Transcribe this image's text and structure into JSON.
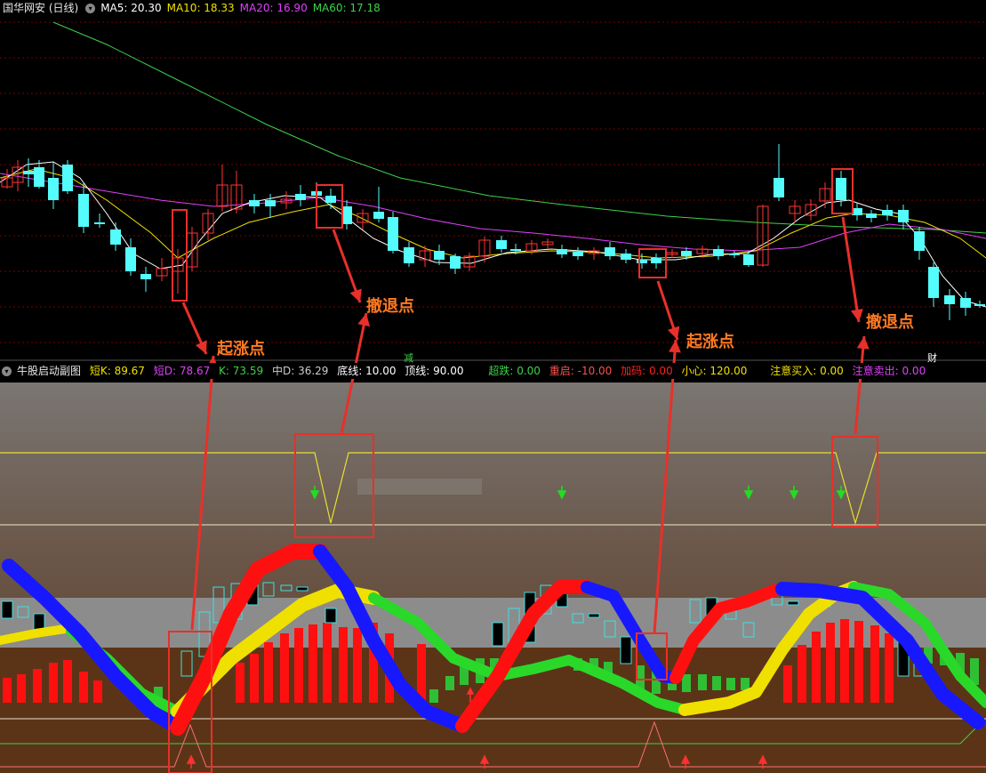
{
  "header": {
    "stock": "国华网安 (日线)",
    "ma": [
      {
        "label": "MA5: 20.30",
        "color": "#ffffff"
      },
      {
        "label": "MA10: 18.33",
        "color": "#f0e000"
      },
      {
        "label": "MA20: 16.90",
        "color": "#e040fb"
      },
      {
        "label": "MA60: 17.18",
        "color": "#3fd14a"
      }
    ]
  },
  "sub_header": {
    "title": "牛股启动副图",
    "items": [
      {
        "label": "短K: 89.67",
        "color": "#f0e000"
      },
      {
        "label": "短D: 78.67",
        "color": "#e040fb"
      },
      {
        "label": "K: 73.59",
        "color": "#3fd14a"
      },
      {
        "label": "中D: 36.29",
        "color": "#cccccc"
      },
      {
        "label": "底线: 10.00",
        "color": "#ffffff"
      },
      {
        "label": "顶线: 90.00",
        "color": "#ffffff"
      },
      {
        "label": "超跌: 0.00",
        "color": "#3fd14a"
      },
      {
        "label": "重启: -10.00",
        "color": "#ff5050"
      },
      {
        "label": "加码: 0.00",
        "color": "#ff2020"
      },
      {
        "label": "小心: 120.00",
        "color": "#f0e000"
      },
      {
        "label": "注意买入: 0.00",
        "color": "#f0e000"
      },
      {
        "label": "注意卖出: 0.00",
        "color": "#e040fb"
      }
    ]
  },
  "tags": {
    "reduce": "减",
    "finance": "财"
  },
  "annotations": {
    "rise": "起涨点",
    "retreat": "撤退点"
  },
  "colors": {
    "up": "#ff3333",
    "down": "#54fcfc",
    "ma5": "#ffffff",
    "ma10": "#f0e000",
    "ma20": "#e040fb",
    "ma60": "#3fd14a",
    "box": "#e8302a"
  },
  "chart_data": [
    {
      "type": "candlestick",
      "title": "国华网安 (日线)",
      "series": [
        {
          "name": "MA5",
          "value": 20.3
        },
        {
          "name": "MA10",
          "value": 18.33
        },
        {
          "name": "MA20",
          "value": 16.9
        },
        {
          "name": "MA60",
          "value": 17.18
        }
      ]
    },
    {
      "type": "line",
      "title": "牛股启动副图",
      "series": [
        {
          "name": "短K",
          "value": 89.67
        },
        {
          "name": "短D",
          "value": 78.67
        },
        {
          "name": "K",
          "value": 73.59
        },
        {
          "name": "中D",
          "value": 36.29
        },
        {
          "name": "底线",
          "value": 10.0
        },
        {
          "name": "顶线",
          "value": 90.0
        },
        {
          "name": "超跌",
          "value": 0.0
        },
        {
          "name": "重启",
          "value": -10.0
        },
        {
          "name": "加码",
          "value": 0.0
        },
        {
          "name": "小心",
          "value": 120.0
        },
        {
          "name": "注意买入",
          "value": 0.0
        },
        {
          "name": "注意卖出",
          "value": 0.0
        }
      ]
    }
  ]
}
